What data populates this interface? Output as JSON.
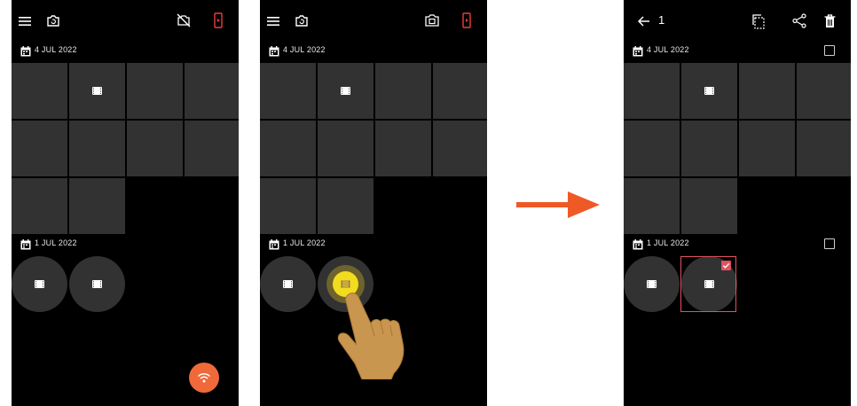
{
  "colors": {
    "accent": "#f0693a",
    "background": "#000000",
    "tile": "#323232",
    "selection": "#e05260"
  },
  "screen1": {
    "toolbar_icons": [
      "menu-icon",
      "camera-switch-icon",
      "camera-off-icon",
      "phone-recording-icon"
    ],
    "sections": [
      {
        "date": "4 JUL 2022",
        "items": 10
      },
      {
        "date": "1 JUL 2022",
        "items": 2
      }
    ],
    "fab_icon": "wifi-icon"
  },
  "screen2": {
    "toolbar_icons": [
      "menu-icon",
      "camera-switch-icon",
      "camera-icon",
      "phone-recording-icon"
    ],
    "sections": [
      {
        "date": "4 JUL 2022",
        "items": 10
      },
      {
        "date": "1 JUL 2022",
        "items": 2
      }
    ],
    "gesture": "long-press"
  },
  "screen3": {
    "selected_count": "1",
    "toolbar_icons": [
      "back-arrow-icon",
      "select-all-icon",
      "share-icon",
      "delete-icon"
    ],
    "sections": [
      {
        "date": "4 JUL 2022",
        "items": 10
      },
      {
        "date": "1 JUL 2022",
        "items": 2
      }
    ]
  }
}
